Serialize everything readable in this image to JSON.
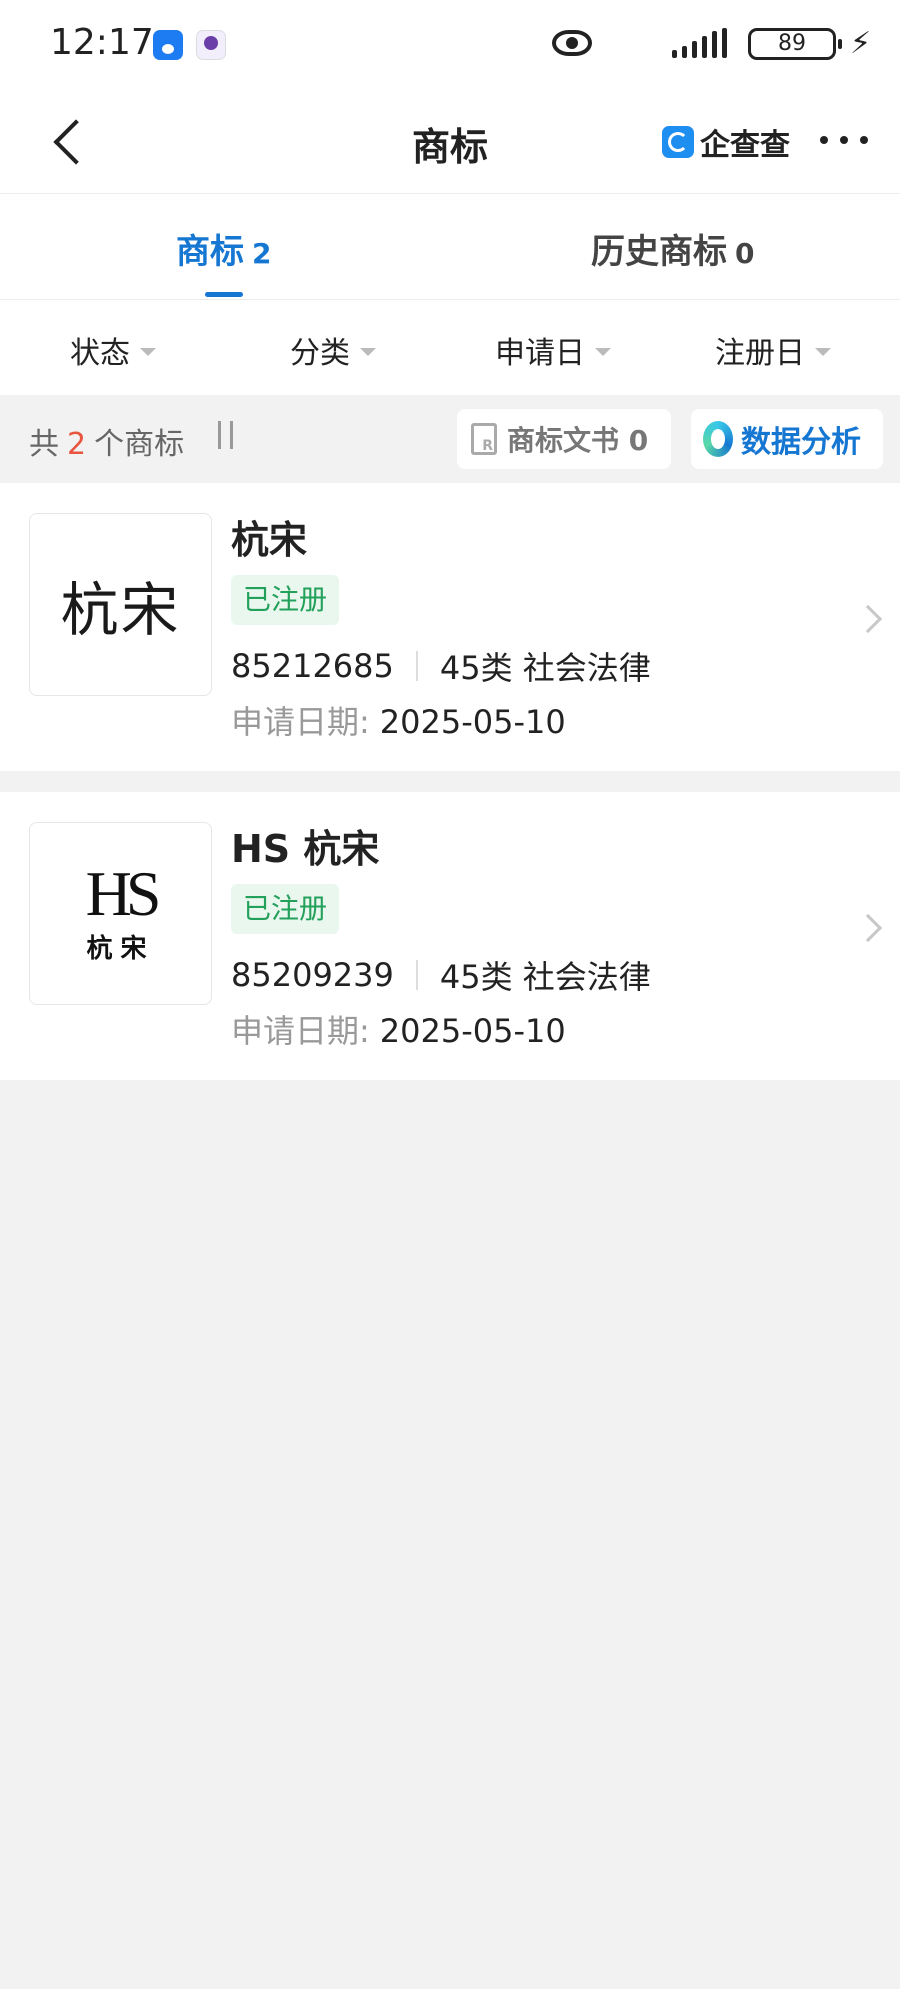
{
  "status_bar": {
    "time": "12:17",
    "battery": "89",
    "app_icons": [
      "autohome-app-icon",
      "notification-app-icon"
    ]
  },
  "nav": {
    "title": "商标",
    "brand": "企查查",
    "icons": [
      "back-icon",
      "qcc-logo-icon",
      "more-icon"
    ]
  },
  "tabs": [
    {
      "label": "商标",
      "count": "2",
      "active": true
    },
    {
      "label": "历史商标",
      "count": "0",
      "active": false
    }
  ],
  "filters": [
    {
      "label": "状态"
    },
    {
      "label": "分类"
    },
    {
      "label": "申请日"
    },
    {
      "label": "注册日"
    }
  ],
  "summary": {
    "prefix": "共",
    "count": "2",
    "suffix": "个商标",
    "doc_button": "商标文书 0",
    "analysis_button": "数据分析"
  },
  "trademarks": [
    {
      "logo_text": "杭宋",
      "name": "杭宋",
      "status": "已注册",
      "reg_no": "85212685",
      "category": "45类 社会法律",
      "date_label": "申请日期:",
      "date": "2025-05-10"
    },
    {
      "logo_mono": "HS",
      "logo_sub": "杭宋",
      "name": "HS 杭宋",
      "status": "已注册",
      "reg_no": "85209239",
      "category": "45类 社会法律",
      "date_label": "申请日期:",
      "date": "2025-05-10"
    }
  ],
  "colors": {
    "accent": "#1677d2",
    "status_green": "#23a05a",
    "count_red": "#e8563f"
  }
}
